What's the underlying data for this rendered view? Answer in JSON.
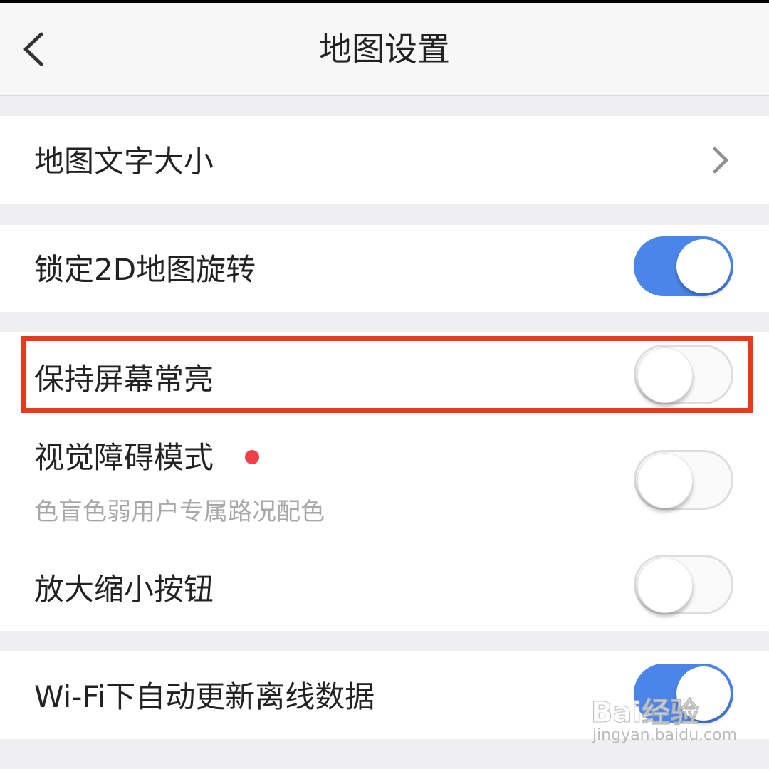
{
  "header": {
    "title": "地图设置"
  },
  "settings": {
    "map_text_size": {
      "label": "地图文字大小"
    },
    "lock_2d_rotation": {
      "label": "锁定2D地图旋转",
      "enabled": true
    },
    "keep_screen_on": {
      "label": "保持屏幕常亮",
      "enabled": false
    },
    "visual_impairment_mode": {
      "label": "视觉障碍模式",
      "description": "色盲色弱用户专属路况配色",
      "enabled": false,
      "badge_color": "#f2404a"
    },
    "zoom_buttons": {
      "label": "放大缩小按钮",
      "enabled": false
    },
    "wifi_auto_update": {
      "label": "Wi-Fi下自动更新离线数据",
      "enabled": true
    }
  },
  "colors": {
    "toggle_on": "#4a86ea",
    "highlight_box": "#e8391d"
  },
  "watermark": {
    "brand": "Bai经验",
    "site": "jingyan.baidu.com"
  }
}
